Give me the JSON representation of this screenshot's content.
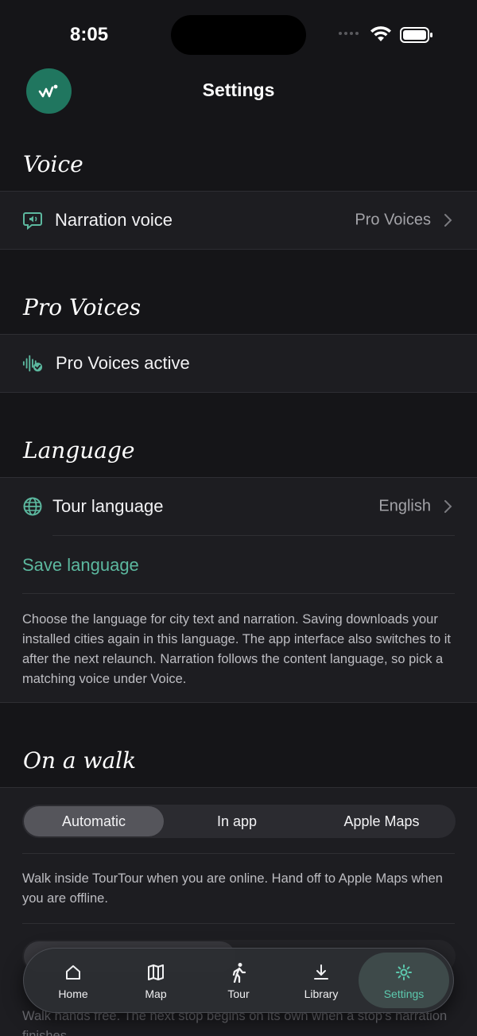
{
  "status_bar": {
    "time": "8:05"
  },
  "header": {
    "title": "Settings"
  },
  "voice": {
    "heading": "Voice",
    "narration_label": "Narration voice",
    "narration_value": "Pro Voices"
  },
  "pro_voices": {
    "heading": "Pro Voices",
    "status_label": "Pro Voices active"
  },
  "language": {
    "heading": "Language",
    "tour_language_label": "Tour language",
    "tour_language_value": "English",
    "save_label": "Save language",
    "description": "Choose the language for city text and narration. Saving downloads your installed cities again in this language. The app interface also switches to it after the next relaunch. Narration follows the content language, so pick a matching voice under Voice."
  },
  "walk": {
    "heading": "On a walk",
    "options": [
      "Automatic",
      "In app",
      "Apple Maps"
    ],
    "selected": "Automatic",
    "description": "Walk inside TourTour when you are online. Hand off to Apple Maps when you are offline.",
    "bottom_description": "Walk hands free. The next stop begins on its own when a stop's narration finishes."
  },
  "tabbar": {
    "items": [
      {
        "label": "Home",
        "icon": "home-icon"
      },
      {
        "label": "Map",
        "icon": "map-icon"
      },
      {
        "label": "Tour",
        "icon": "walking-icon"
      },
      {
        "label": "Library",
        "icon": "download-icon"
      },
      {
        "label": "Settings",
        "icon": "gear-icon"
      }
    ],
    "active": "Settings"
  },
  "colors": {
    "accent": "#5cb89f",
    "background": "#151518",
    "row": "#1d1d21",
    "logo": "#20765f"
  }
}
